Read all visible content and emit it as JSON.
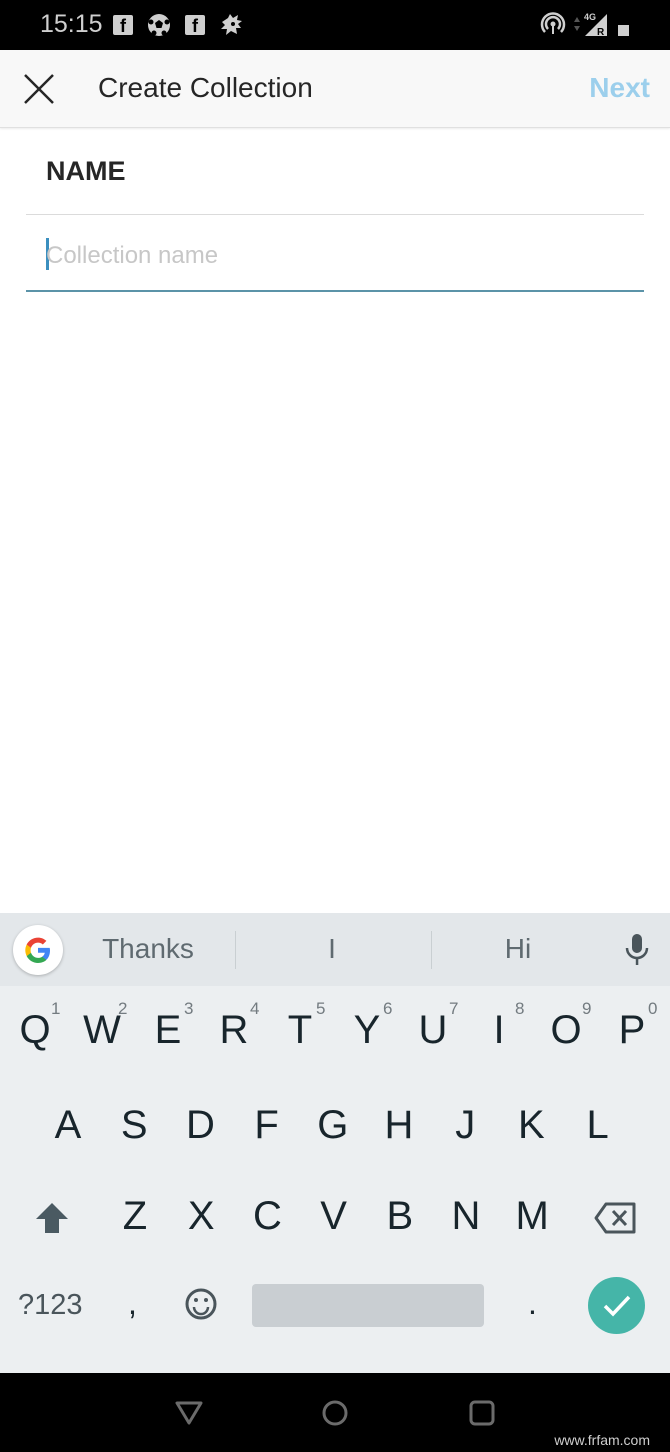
{
  "status_bar": {
    "time": "15:15",
    "notification_icons": [
      "facebook-icon",
      "soccer-ball-icon",
      "facebook-icon",
      "sonic-icon"
    ],
    "network_label": "4G",
    "roaming_label": "R"
  },
  "app_bar": {
    "close_icon": "close-icon",
    "title": "Create Collection",
    "next_label": "Next",
    "next_color": "#9ccfec"
  },
  "form": {
    "name_label": "NAME",
    "name_input": {
      "value": "",
      "placeholder": "Collection name"
    },
    "accent_color": "#5b93a8"
  },
  "keyboard": {
    "suggestions": [
      "Thanks",
      "I",
      "Hi"
    ],
    "row1": [
      {
        "key": "Q",
        "hint": "1"
      },
      {
        "key": "W",
        "hint": "2"
      },
      {
        "key": "E",
        "hint": "3"
      },
      {
        "key": "R",
        "hint": "4"
      },
      {
        "key": "T",
        "hint": "5"
      },
      {
        "key": "Y",
        "hint": "6"
      },
      {
        "key": "U",
        "hint": "7"
      },
      {
        "key": "I",
        "hint": "8"
      },
      {
        "key": "O",
        "hint": "9"
      },
      {
        "key": "P",
        "hint": "0"
      }
    ],
    "row2": [
      "A",
      "S",
      "D",
      "F",
      "G",
      "H",
      "J",
      "K",
      "L"
    ],
    "row3": [
      "Z",
      "X",
      "C",
      "V",
      "B",
      "N",
      "M"
    ],
    "symbols_label": "?123",
    "comma_label": ",",
    "period_label": ".",
    "enter_color": "#45b5a8"
  },
  "nav_bar": {
    "buttons": [
      "back-icon",
      "home-icon",
      "recents-icon"
    ]
  },
  "watermark": "www.frfam.com"
}
